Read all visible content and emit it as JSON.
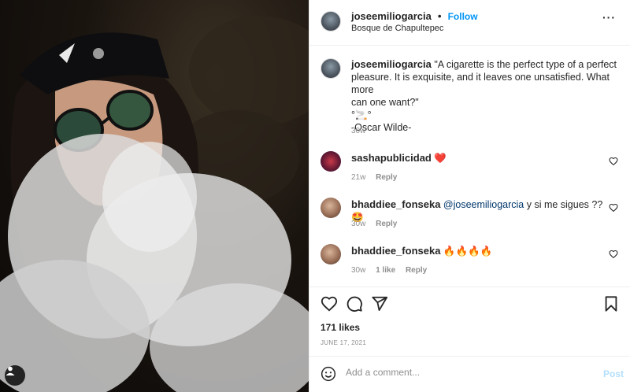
{
  "post": {
    "author": "joseemiliogarcia",
    "follow_label": "Follow",
    "separator": "•",
    "location": "Bosque de Chapultepec",
    "more_label": "···"
  },
  "caption": {
    "author": "joseemiliogarcia",
    "line1": "\"A cigarette is the perfect type of a perfect",
    "line2": "pleasure. It is exquisite, and it leaves one unsatisfied. What more",
    "line3": "can one want?\"",
    "line4": "°🚬°",
    "line5": "-Oscar Wilde-",
    "time": "30w"
  },
  "comments": [
    {
      "author": "sashapublicidad",
      "text": "❤️",
      "time": "21w",
      "reply_label": "Reply"
    },
    {
      "author": "bhaddiee_fonseka",
      "mention": "@joseemiliogarcia",
      "text": " y si me sigues ?? 🤩",
      "time": "30w",
      "reply_label": "Reply"
    },
    {
      "author": "bhaddiee_fonseka",
      "text": "🔥🔥🔥🔥",
      "time": "30w",
      "likes": "1 like",
      "reply_label": "Reply"
    }
  ],
  "actions": {
    "likes": "171 likes",
    "date": "JUNE 17, 2021"
  },
  "add_comment": {
    "placeholder": "Add a comment...",
    "post_label": "Post"
  },
  "colors": {
    "accent": "#0095f6",
    "post_disabled": "#b2dffc",
    "muted": "#8e8e8e",
    "heart": "#ed4956"
  }
}
